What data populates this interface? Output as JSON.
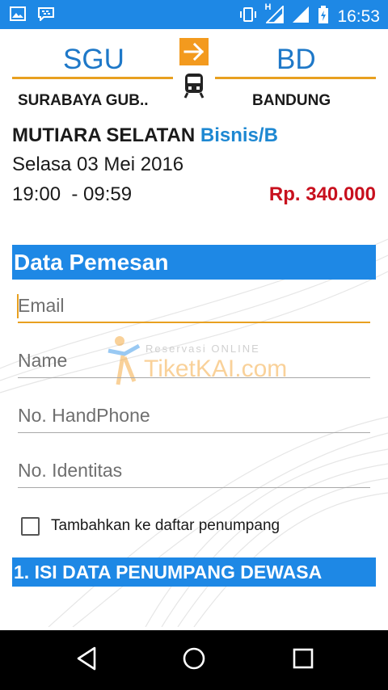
{
  "status_bar": {
    "time": "16:53",
    "network_letter": "H",
    "left_icons": [
      "image-icon",
      "bbm-icon"
    ],
    "right_icons": [
      "vibrate-icon",
      "signal-h-icon",
      "signal-icon",
      "battery-charging-icon"
    ]
  },
  "route": {
    "from_code": "SGU",
    "to_code": "BD",
    "from_station": "SURABAYA GUB..",
    "to_station": "BANDUNG"
  },
  "trip": {
    "train_name": "MUTIARA SELATAN",
    "train_class": "Bisnis/B",
    "date": "Selasa 03 Mei 2016",
    "time": "19:00  - 09:59",
    "price": "Rp. 340.000"
  },
  "watermark": {
    "line1": "Reservasi ONLINE",
    "line2": "TiketKAI.com"
  },
  "form": {
    "section_title": "Data Pemesan",
    "email_placeholder": "Email",
    "name_placeholder": "Name",
    "phone_placeholder": "No. HandPhone",
    "id_placeholder": "No. Identitas",
    "checkbox_label": "Tambahkan ke daftar penumpang",
    "checkbox_checked": false
  },
  "passenger_section_title": "1. ISI DATA PENUMPANG DEWASA",
  "colors": {
    "primary": "#1e88e5",
    "accent": "#f39a1e",
    "price": "#c8101e",
    "class_text": "#1e88d2"
  }
}
